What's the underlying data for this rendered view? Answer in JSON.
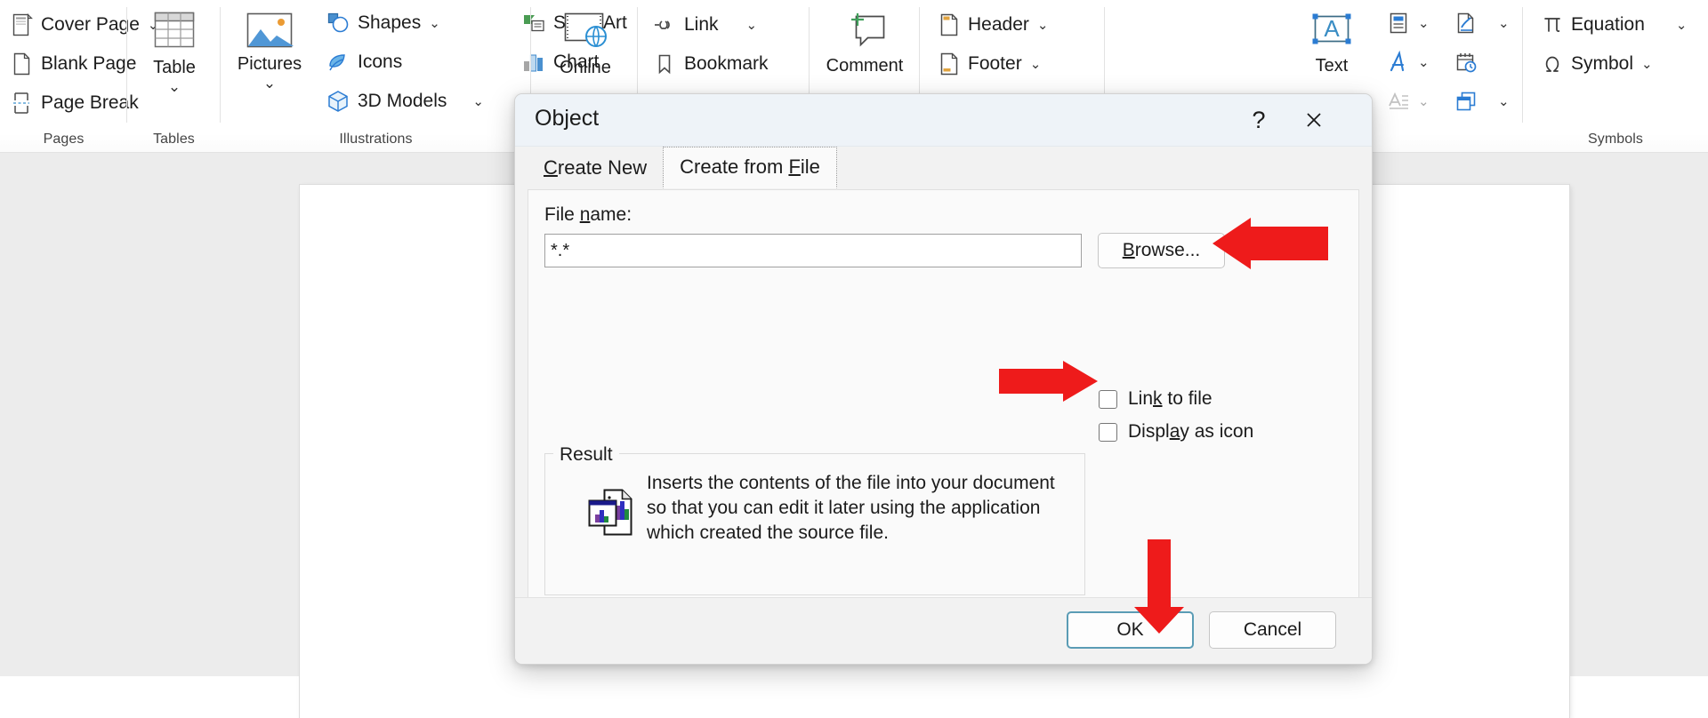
{
  "ribbon": {
    "groups": [
      {
        "name": "Pages",
        "label": "Pages",
        "items": [
          {
            "label": "Cover Page",
            "icon": "cover-page-icon",
            "chevron": "⌄"
          },
          {
            "label": "Blank Page",
            "icon": "blank-page-icon",
            "chevron": ""
          },
          {
            "label": "Page Break",
            "icon": "page-break-icon",
            "chevron": ""
          }
        ]
      },
      {
        "name": "Tables",
        "label": "Tables",
        "items": [
          {
            "label": "Table",
            "icon": "table-icon",
            "chevron": "⌄"
          }
        ]
      },
      {
        "name": "Illustrations",
        "label": "Illustrations",
        "items": [
          {
            "label": "Pictures",
            "icon": "pictures-icon",
            "chevron": "⌄"
          },
          {
            "label": "Shapes",
            "icon": "shapes-icon",
            "chevron": "⌄"
          },
          {
            "label": "Icons",
            "icon": "icons-icon",
            "chevron": ""
          },
          {
            "label": "3D Models",
            "icon": "3d-models-icon",
            "chevron": "⌄"
          },
          {
            "label": "SmartArt",
            "icon": "smartart-icon",
            "chevron": ""
          },
          {
            "label": "Chart",
            "icon": "chart-icon",
            "chevron": ""
          }
        ]
      },
      {
        "name": "Media",
        "label": "",
        "items": [
          {
            "label": "Online",
            "icon": "online-video-icon",
            "chevron": ""
          }
        ]
      },
      {
        "name": "Links",
        "label": "",
        "items": [
          {
            "label": "Link",
            "icon": "link-icon",
            "chevron": "⌄"
          },
          {
            "label": "Bookmark",
            "icon": "bookmark-icon",
            "chevron": ""
          }
        ]
      },
      {
        "name": "Comments",
        "label": "",
        "items": [
          {
            "label": "Comment",
            "icon": "new-comment-icon",
            "chevron": ""
          }
        ]
      },
      {
        "name": "HeaderFooter",
        "label": "",
        "items": [
          {
            "label": "Header",
            "icon": "header-icon",
            "chevron": "⌄"
          },
          {
            "label": "Footer",
            "icon": "footer-icon",
            "chevron": "⌄"
          }
        ]
      },
      {
        "name": "Text",
        "label": "Text",
        "items": [
          {
            "label": "Text",
            "icon": "text-box-icon",
            "chevron": ""
          },
          {
            "label": "",
            "icon": "quick-parts-icon",
            "chevron": "⌄"
          },
          {
            "label": "",
            "icon": "wordart-icon",
            "chevron": "⌄"
          },
          {
            "label": "",
            "icon": "drop-cap-icon",
            "chevron": "⌄"
          },
          {
            "label": "",
            "icon": "signature-line-icon",
            "chevron": "⌄"
          },
          {
            "label": "",
            "icon": "date-time-icon",
            "chevron": ""
          },
          {
            "label": "",
            "icon": "object-icon",
            "chevron": "⌄"
          }
        ]
      },
      {
        "name": "Symbols",
        "label": "Symbols",
        "items": [
          {
            "label": "Equation",
            "icon": "equation-icon",
            "chevron": "⌄"
          },
          {
            "label": "Symbol",
            "icon": "symbol-icon",
            "chevron": "⌄"
          }
        ]
      }
    ]
  },
  "dialog": {
    "title": "Object",
    "help_icon": "?",
    "close_icon": "✕",
    "tabs": [
      {
        "pre": "",
        "acc": "C",
        "post": "reate New",
        "active": false,
        "name": "create-new"
      },
      {
        "pre": "Create from ",
        "acc": "F",
        "post": "ile",
        "active": true,
        "name": "create-from-file"
      }
    ],
    "file_name_label_pre": "File ",
    "file_name_label_acc": "n",
    "file_name_label_post": "ame:",
    "file_name_value": "*.*",
    "file_name_placeholder": "*.*",
    "browse_pre": "",
    "browse_acc": "B",
    "browse_post": "rowse...",
    "checkboxes": [
      {
        "pre": "Lin",
        "acc": "k",
        "post": " to file",
        "checked": false,
        "name": "link-to-file"
      },
      {
        "pre": "Displ",
        "acc": "a",
        "post": "y as icon",
        "checked": false,
        "name": "display-as-icon"
      }
    ],
    "result_legend": "Result",
    "result_text": "Inserts the contents of the file into your document so that you can edit it later using the application which created the source file.",
    "ok_label": "OK",
    "cancel_label": "Cancel"
  },
  "annotations": {
    "arrow_color": "#EE1B1B",
    "arrows": [
      {
        "name": "arrow-to-browse",
        "direction": "left",
        "target": "browse-button"
      },
      {
        "name": "arrow-to-display-as-icon",
        "direction": "right",
        "target": "display-as-icon-checkbox"
      },
      {
        "name": "arrow-to-ok",
        "direction": "down",
        "target": "ok-button"
      }
    ]
  },
  "colors": {
    "accent": "#2B7CD3",
    "dialog_title_bg": "#EEF3F8",
    "focus_border": "#5A9CB5",
    "red": "#EE1B1B"
  }
}
